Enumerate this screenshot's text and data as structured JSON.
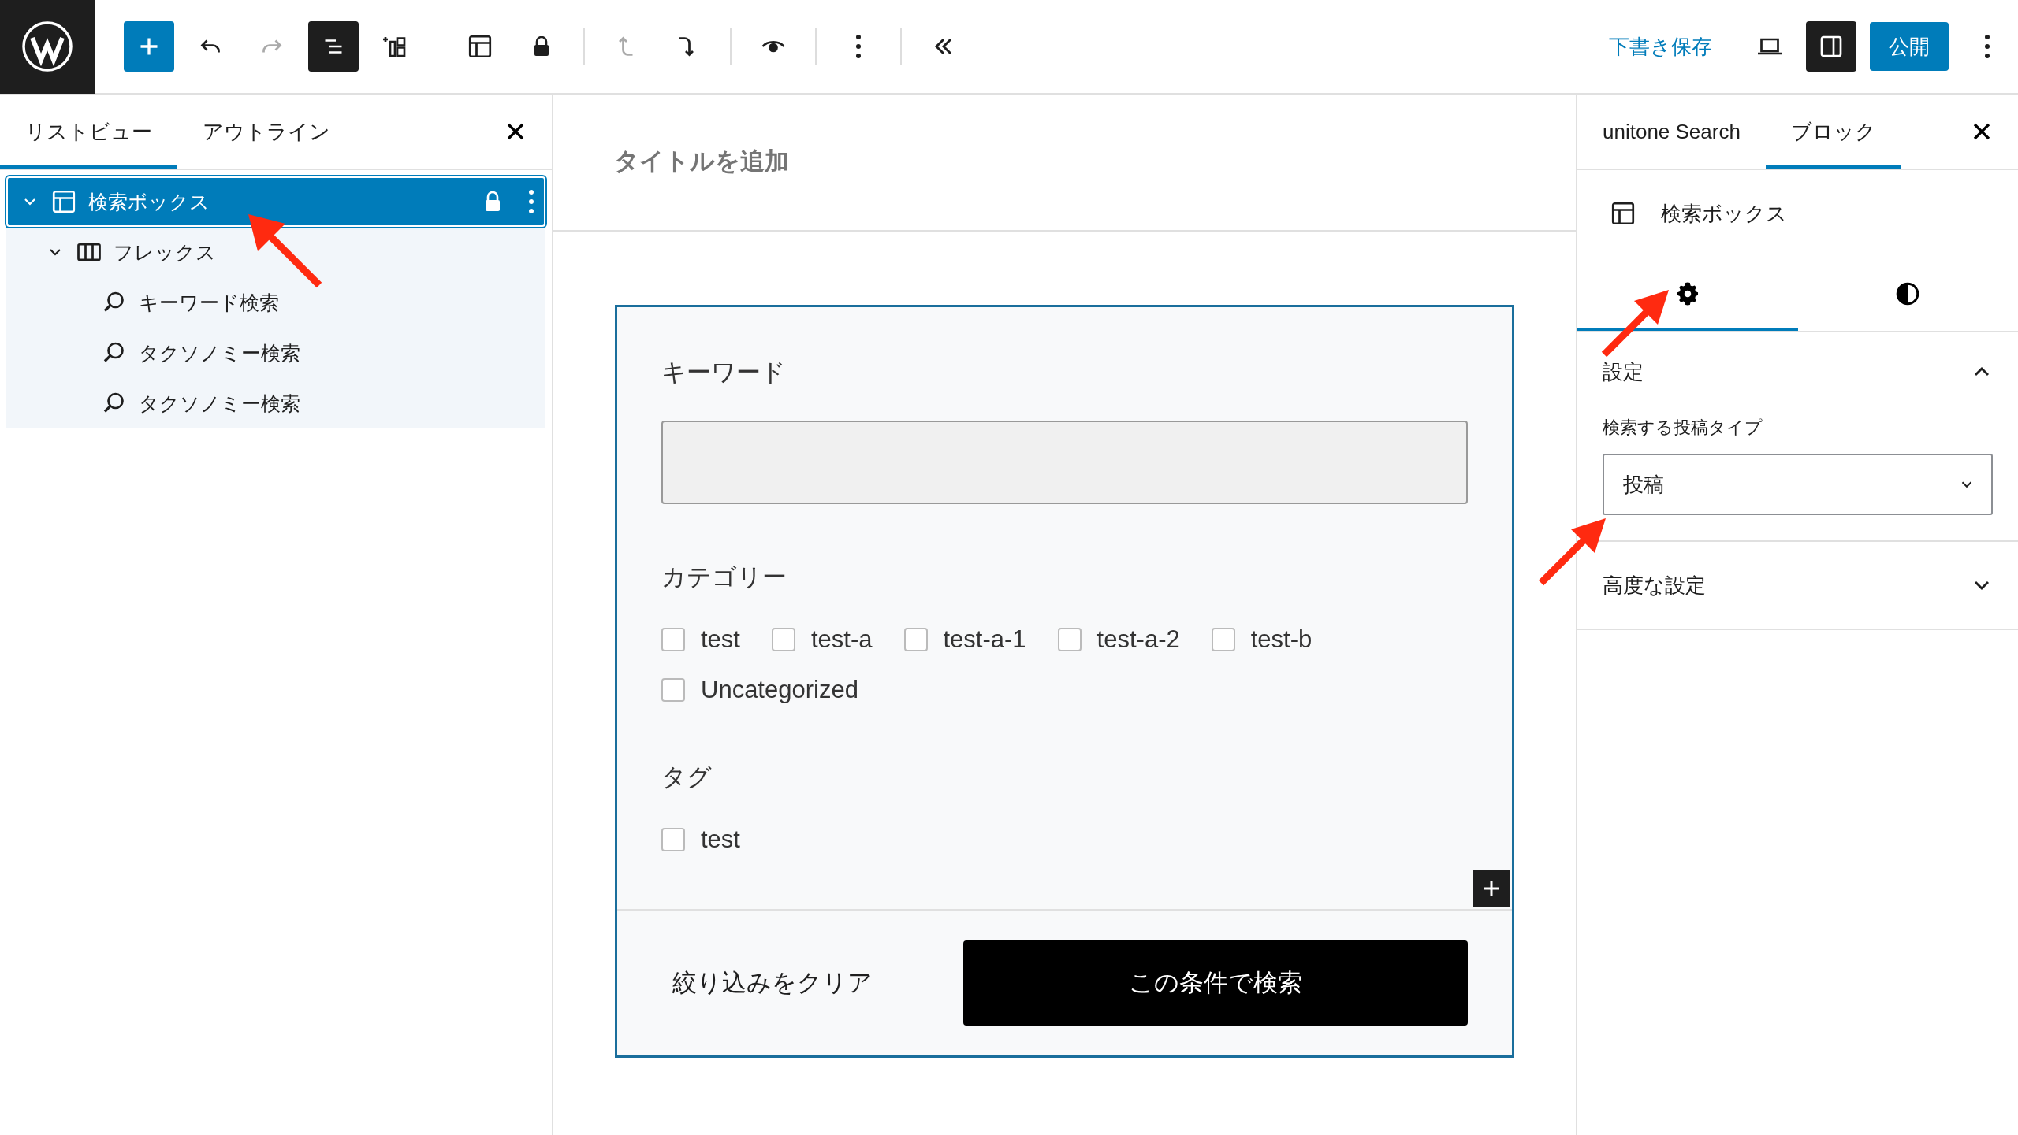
{
  "toolbar": {
    "list_view_open": true,
    "redo_disabled": true,
    "move_up_disabled": true,
    "save_draft": "下書き保存",
    "settings_open": true,
    "publish": "公開"
  },
  "left_panel": {
    "tabs": [
      {
        "label": "リストビュー",
        "selected": true
      },
      {
        "label": "アウトライン",
        "selected": false
      }
    ],
    "tree": [
      {
        "label": "検索ボックス",
        "kind": "layout",
        "selected": true,
        "locked": true,
        "expanded": true,
        "children": [
          {
            "label": "フレックス",
            "kind": "columns",
            "selected": false,
            "locked": false,
            "expanded": true,
            "children": [
              {
                "label": "キーワード検索",
                "kind": "search",
                "selected": false,
                "locked": false
              },
              {
                "label": "タクソノミー検索",
                "kind": "search",
                "selected": false,
                "locked": false
              },
              {
                "label": "タクソノミー検索",
                "kind": "search",
                "selected": false,
                "locked": false
              }
            ]
          }
        ]
      }
    ]
  },
  "editor": {
    "title_placeholder": "タイトルを追加",
    "sections": [
      {
        "kind": "keyword",
        "label": "キーワード"
      },
      {
        "kind": "checkboxes",
        "label": "カテゴリー",
        "options": [
          {
            "label": "test",
            "checked": false
          },
          {
            "label": "test-a",
            "checked": false
          },
          {
            "label": "test-a-1",
            "checked": false
          },
          {
            "label": "test-a-2",
            "checked": false
          },
          {
            "label": "test-b",
            "checked": false
          },
          {
            "label": "Uncategorized",
            "checked": false
          }
        ]
      },
      {
        "kind": "checkboxes",
        "label": "タグ",
        "options": [
          {
            "label": "test",
            "checked": false
          }
        ]
      }
    ],
    "clear_button": "絞り込みをクリア",
    "search_button": "この条件で検索"
  },
  "right_panel": {
    "tabs": [
      {
        "label": "unitone Search",
        "selected": false
      },
      {
        "label": "ブロック",
        "selected": true
      }
    ],
    "block_name": "検索ボックス",
    "sub_tabs": [
      {
        "kind": "settings",
        "selected": true
      },
      {
        "kind": "styles",
        "selected": false
      }
    ],
    "panels": [
      {
        "title": "設定",
        "expanded": true,
        "field": {
          "label": "検索する投稿タイプ",
          "value": "投稿"
        }
      },
      {
        "title": "高度な設定",
        "expanded": false
      }
    ]
  }
}
